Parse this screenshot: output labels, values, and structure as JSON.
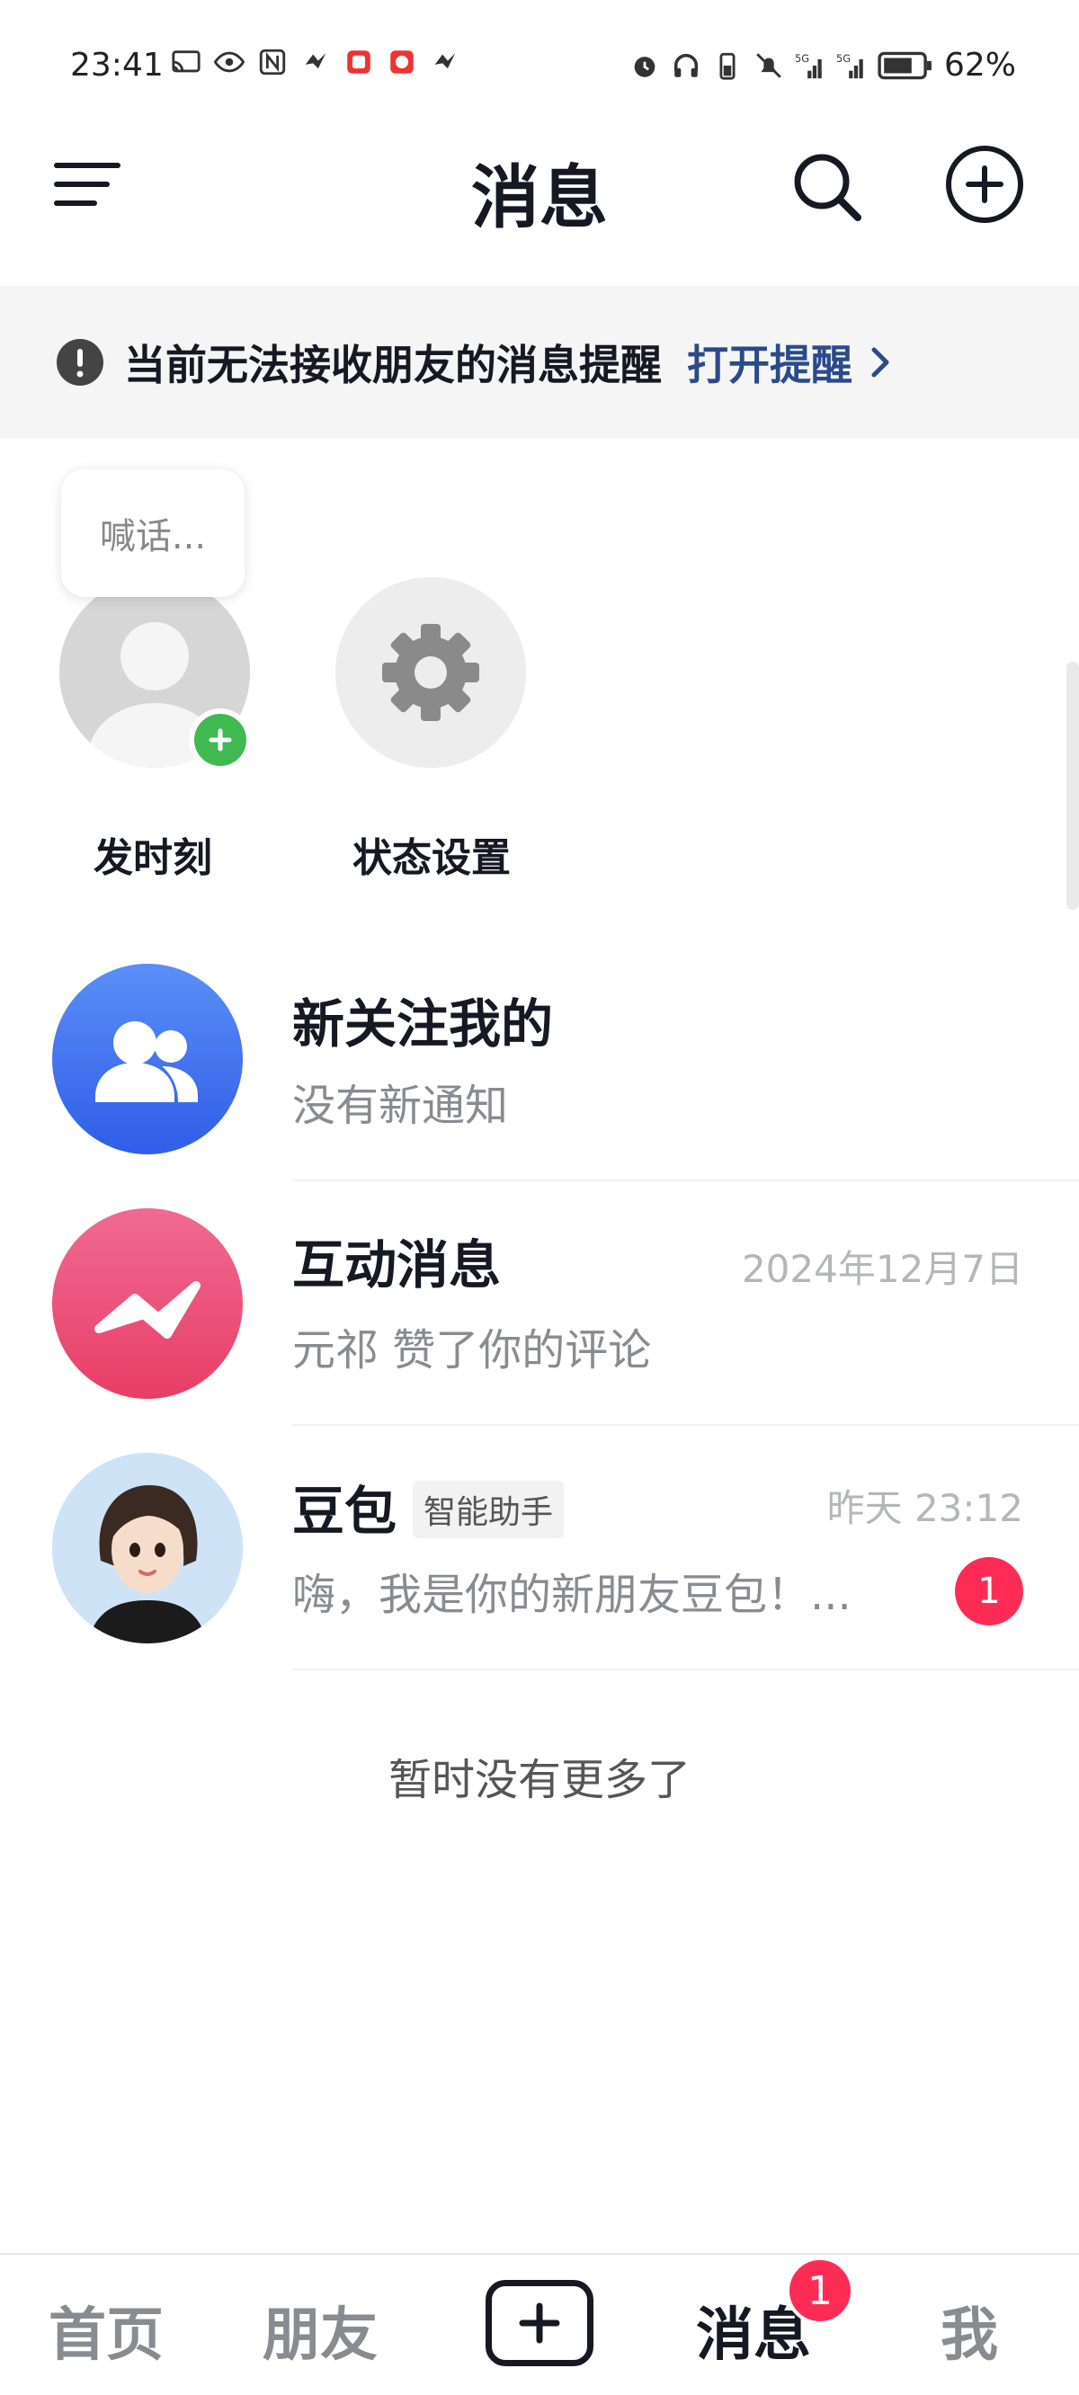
{
  "status_bar": {
    "time": "23:41",
    "battery": "62%",
    "left_icons": [
      "cast-icon",
      "eye-icon",
      "nfc-icon",
      "app-icon",
      "app-icon",
      "app-icon",
      "app-icon"
    ],
    "right_icons": [
      "alarm-icon",
      "headphones-icon",
      "battery-saver-icon",
      "mute-icon",
      "signal-5g-icon",
      "signal-5g-icon",
      "battery-icon"
    ]
  },
  "header": {
    "title": "消息"
  },
  "notice": {
    "text": "当前无法接收朋友的消息提醒",
    "link": "打开提醒"
  },
  "moments": {
    "bubble_placeholder": "喊话...",
    "items": [
      {
        "label": "发时刻"
      },
      {
        "label": "状态设置"
      }
    ]
  },
  "conversations": [
    {
      "title": "新关注我的",
      "subtitle": "没有新通知",
      "time": "",
      "badge": ""
    },
    {
      "title": "互动消息",
      "subtitle": "元祁 赞了你的评论",
      "time": "2024年12月7日",
      "badge": ""
    },
    {
      "title": "豆包",
      "tag": "智能助手",
      "subtitle": "嗨，我是你的新朋友豆包！...",
      "time": "昨天 23:12",
      "badge": "1"
    }
  ],
  "no_more": "暂时没有更多了",
  "tabbar": {
    "items": [
      {
        "label": "首页"
      },
      {
        "label": "朋友"
      },
      {
        "label": "消息"
      },
      {
        "label": "我"
      }
    ],
    "messages_badge": "1"
  },
  "colors": {
    "accent_red": "#fe2c55",
    "link_blue": "#2c4a8a",
    "follow_blue": "#3a6cf4",
    "interact_pink": "#ee4d7c"
  }
}
